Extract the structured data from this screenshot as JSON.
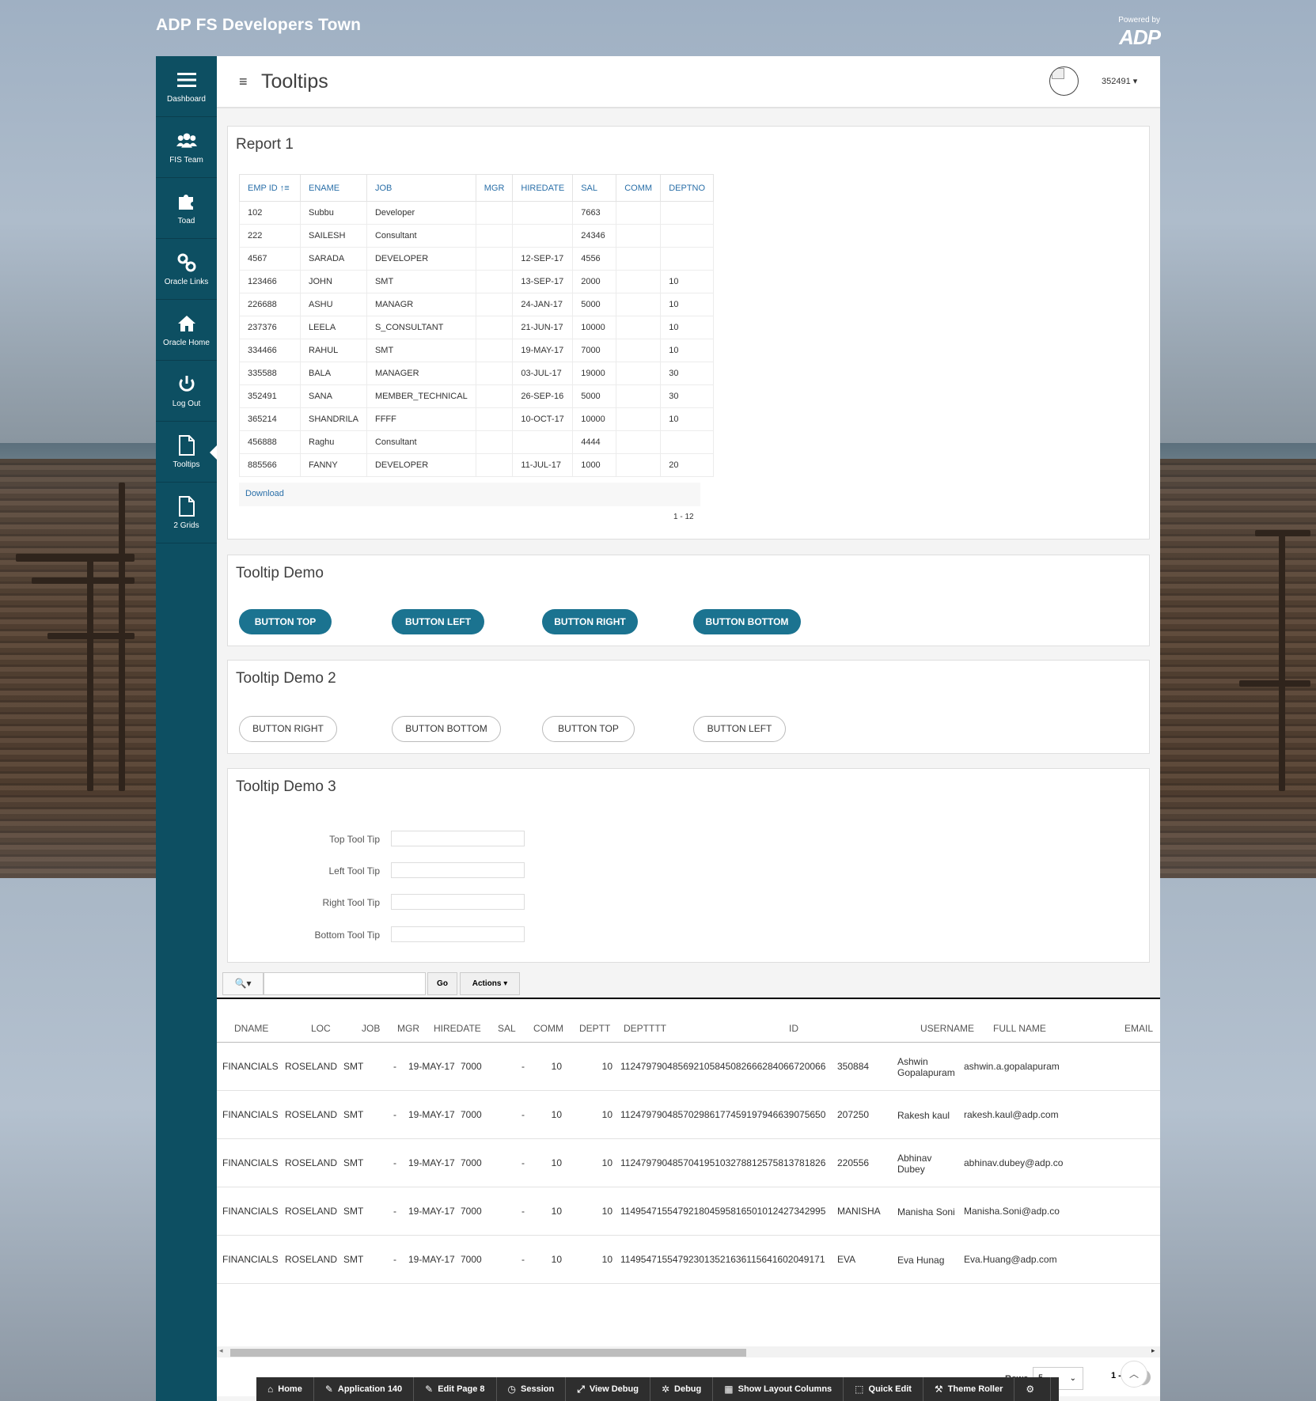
{
  "app": {
    "title": "ADP FS Developers Town",
    "powered_by": "Powered by",
    "logo_text": "ADP"
  },
  "sidebar": {
    "items": [
      {
        "label": "Dashboard",
        "icon": "menu-icon"
      },
      {
        "label": "FIS Team",
        "icon": "users-icon"
      },
      {
        "label": "Toad",
        "icon": "puzzle-icon"
      },
      {
        "label": "Oracle Links",
        "icon": "link-icon"
      },
      {
        "label": "Oracle Home",
        "icon": "home-icon"
      },
      {
        "label": "Log Out",
        "icon": "power-icon"
      },
      {
        "label": "Tooltips",
        "icon": "file-icon",
        "active": true
      },
      {
        "label": "2 Grids",
        "icon": "file-icon"
      }
    ]
  },
  "header": {
    "page_title": "Tooltips",
    "user_id": "352491 ▾",
    "menu_icon": "≡"
  },
  "report1": {
    "title": "Report 1",
    "columns": [
      "EMP ID ↑≡",
      "ENAME",
      "JOB",
      "MGR",
      "HIREDATE",
      "SAL",
      "COMM",
      "DEPTNO"
    ],
    "rows": [
      [
        "102",
        "Subbu",
        "Developer",
        "",
        "",
        "7663",
        "",
        ""
      ],
      [
        "222",
        "SAILESH",
        "Consultant",
        "",
        "",
        "24346",
        "",
        ""
      ],
      [
        "4567",
        "SARADA",
        "DEVELOPER",
        "",
        "12-SEP-17",
        "4556",
        "",
        ""
      ],
      [
        "123466",
        "JOHN",
        "SMT",
        "",
        "13-SEP-17",
        "2000",
        "",
        "10"
      ],
      [
        "226688",
        "ASHU",
        "MANAGR",
        "",
        "24-JAN-17",
        "5000",
        "",
        "10"
      ],
      [
        "237376",
        "LEELA",
        "S_CONSULTANT",
        "",
        "21-JUN-17",
        "10000",
        "",
        "10"
      ],
      [
        "334466",
        "RAHUL",
        "SMT",
        "",
        "19-MAY-17",
        "7000",
        "",
        "10"
      ],
      [
        "335588",
        "BALA",
        "MANAGER",
        "",
        "03-JUL-17",
        "19000",
        "",
        "30"
      ],
      [
        "352491",
        "SANA",
        "MEMBER_TECHNICAL",
        "",
        "26-SEP-16",
        "5000",
        "",
        "30"
      ],
      [
        "365214",
        "SHANDRILA",
        "FFFF",
        "",
        "10-OCT-17",
        "10000",
        "",
        "10"
      ],
      [
        "456888",
        "Raghu",
        "Consultant",
        "",
        "",
        "4444",
        "",
        ""
      ],
      [
        "885566",
        "FANNY",
        "DEVELOPER",
        "",
        "11-JUL-17",
        "1000",
        "",
        "20"
      ]
    ],
    "download": "Download",
    "range": "1 - 12"
  },
  "tooltip_demo": {
    "title": "Tooltip Demo",
    "buttons": [
      "BUTTON TOP",
      "BUTTON LEFT",
      "BUTTON RIGHT",
      "BUTTON BOTTOM"
    ]
  },
  "tooltip_demo2": {
    "title": "Tooltip Demo 2",
    "buttons": [
      "BUTTON RIGHT",
      "BUTTON BOTTOM",
      "BUTTON TOP",
      "BUTTON LEFT"
    ]
  },
  "tooltip_demo3": {
    "title": "Tooltip Demo 3",
    "fields": [
      {
        "label": "Top Tool Tip",
        "value": ""
      },
      {
        "label": "Left Tool Tip",
        "value": ""
      },
      {
        "label": "Right Tool Tip",
        "value": ""
      },
      {
        "label": "Bottom Tool Tip",
        "value": ""
      }
    ]
  },
  "ir": {
    "search_icon": "🔍▾",
    "go_label": "Go",
    "actions_label": "Actions ▾",
    "columns": [
      "DNAME",
      "LOC",
      "JOB",
      "MGR",
      "HIREDATE",
      "SAL",
      "COMM",
      "DEPTT",
      "DEPTTTT",
      "ID",
      "USERNAME",
      "FULL NAME",
      "EMAIL"
    ],
    "rows": [
      [
        "FINANCIALS",
        "ROSELAND",
        "SMT",
        "-",
        "19-MAY-17",
        "7000",
        "-",
        "10",
        "10",
        "112479790485692105845082666284066720066",
        "350884",
        "Ashwin Gopalapuram",
        "ashwin.a.gopalapuram"
      ],
      [
        "FINANCIALS",
        "ROSELAND",
        "SMT",
        "-",
        "19-MAY-17",
        "7000",
        "-",
        "10",
        "10",
        "112479790485702986177459197946639075650",
        "207250",
        "Rakesh kaul",
        "rakesh.kaul@adp.com"
      ],
      [
        "FINANCIALS",
        "ROSELAND",
        "SMT",
        "-",
        "19-MAY-17",
        "7000",
        "-",
        "10",
        "10",
        "112479790485704195103278812575813781826",
        "220556",
        "Abhinav Dubey",
        "abhinav.dubey@adp.co"
      ],
      [
        "FINANCIALS",
        "ROSELAND",
        "SMT",
        "-",
        "19-MAY-17",
        "7000",
        "-",
        "10",
        "10",
        "114954715547921804595816501012427342995",
        "MANISHA",
        "Manisha Soni",
        "Manisha.Soni@adp.co"
      ],
      [
        "FINANCIALS",
        "ROSELAND",
        "SMT",
        "-",
        "19-MAY-17",
        "7000",
        "-",
        "10",
        "10",
        "114954715547923013521636115641602049171",
        "EVA",
        "Eva Hunag",
        "Eva.Huang@adp.com"
      ]
    ],
    "rows_label": "Rows",
    "rows_value": "5",
    "range": "1 - 5"
  },
  "devbar": {
    "items": [
      {
        "label": "Home",
        "icon": "⌂"
      },
      {
        "label": "Application 140",
        "icon": "✎"
      },
      {
        "label": "Edit Page 8",
        "icon": "✎"
      },
      {
        "label": "Session",
        "icon": "◷"
      },
      {
        "label": "View Debug",
        "icon": "⤢"
      },
      {
        "label": "Debug",
        "icon": "✲"
      },
      {
        "label": "Show Layout Columns",
        "icon": "▦"
      },
      {
        "label": "Quick Edit",
        "icon": "⬚"
      },
      {
        "label": "Theme Roller",
        "icon": "⚒"
      },
      {
        "label": "",
        "icon": "⚙"
      }
    ]
  }
}
